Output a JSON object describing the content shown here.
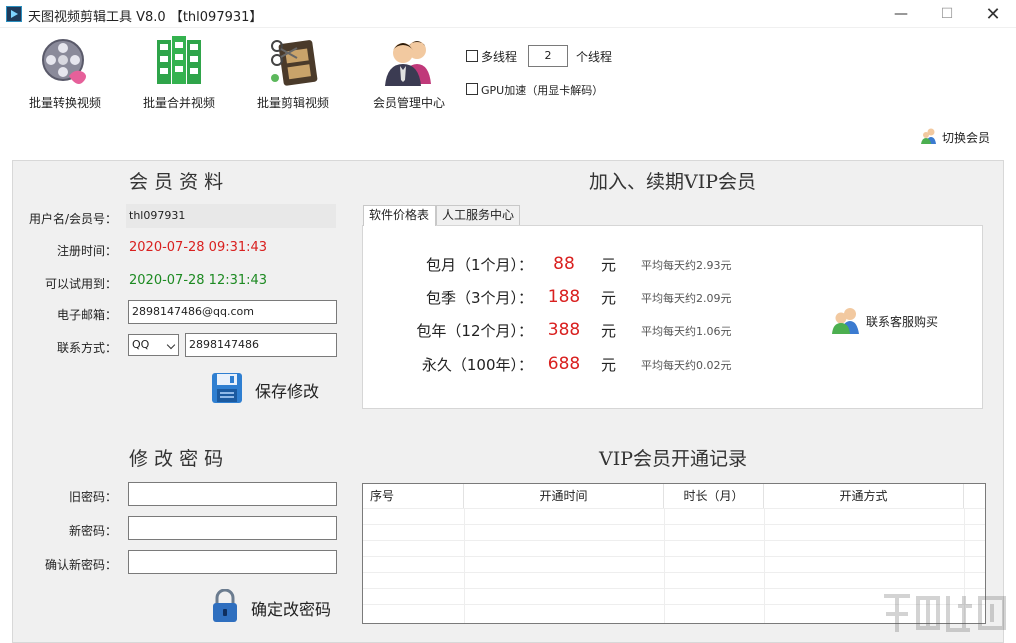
{
  "window": {
    "title": "天图视频剪辑工具 V8.0 【thl097931】",
    "min": "—",
    "max": "☐",
    "close": "✕"
  },
  "toolbar": {
    "batch_convert": "批量转换视频",
    "batch_merge": "批量合并视频",
    "batch_cut": "批量剪辑视频",
    "member_center": "会员管理中心",
    "multithread_label": "多线程",
    "thread_count": "2",
    "thread_unit": "个线程",
    "gpu_label": "GPU加速（用显卡解码）",
    "switch_member": "切换会员"
  },
  "profile": {
    "title": "会 员 资 料",
    "username_label": "用户名/会员号：",
    "username_value": "thl097931",
    "reg_label": "注册时间：",
    "reg_value": "2020-07-28 09:31:43",
    "trial_label": "可以试用到：",
    "trial_value": "2020-07-28 12:31:43",
    "email_label": "电子邮箱：",
    "email_value": "2898147486@qq.com",
    "contact_label": "联系方式：",
    "contact_type": "QQ",
    "contact_value": "2898147486",
    "save_label": "保存修改"
  },
  "password": {
    "title": "修 改 密 码",
    "old_label": "旧密码：",
    "new_label": "新密码：",
    "confirm_label": "确认新密码：",
    "confirm_button": "确定改密码"
  },
  "vip": {
    "title": "加入、续期VIP会员",
    "tabs": [
      "软件价格表",
      "人工服务中心"
    ],
    "plans": [
      {
        "name": "包月（1个月）：",
        "price": "88",
        "unit": "元",
        "avg": "平均每天约2.93元"
      },
      {
        "name": "包季（3个月）：",
        "price": "188",
        "unit": "元",
        "avg": "平均每天约2.09元"
      },
      {
        "name": "包年（12个月）：",
        "price": "388",
        "unit": "元",
        "avg": "平均每天约1.06元"
      },
      {
        "name": "永久（100年）：",
        "price": "688",
        "unit": "元",
        "avg": "平均每天约0.02元"
      }
    ],
    "buy_label": "联系客服购买"
  },
  "records": {
    "title": "VIP会员开通记录",
    "columns": [
      "序号",
      "开通时间",
      "时长（月）",
      "开通方式"
    ]
  },
  "colors": {
    "accent_red": "#d9201f",
    "accent_green": "#1d8a22",
    "panel_bg": "#f0f0f0"
  }
}
